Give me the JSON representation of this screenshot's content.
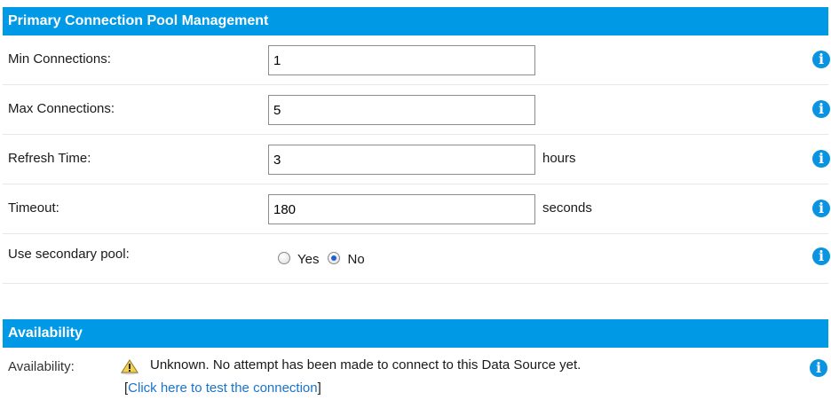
{
  "pool": {
    "header": "Primary Connection Pool Management",
    "rows": [
      {
        "label": "Min Connections:",
        "value": "1",
        "unit": ""
      },
      {
        "label": "Max Connections:",
        "value": "5",
        "unit": ""
      },
      {
        "label": "Refresh Time:",
        "value": "3",
        "unit": "hours"
      },
      {
        "label": "Timeout:",
        "value": "180",
        "unit": "seconds"
      }
    ],
    "secondary": {
      "label": "Use secondary pool:",
      "yes": "Yes",
      "no": "No",
      "selected": "No"
    }
  },
  "availability": {
    "header": "Availability",
    "label": "Availability:",
    "message": "Unknown. No attempt has been made to connect to this Data Source yet.",
    "link_open": "[",
    "link_text": "Click here to test the connection",
    "link_close": "]"
  },
  "icons": {
    "info": "info-icon",
    "warning": "warning-icon"
  },
  "colors": {
    "header_bg": "#0099e6",
    "info_icon": "#0a93e0",
    "link": "#1a73c9"
  }
}
